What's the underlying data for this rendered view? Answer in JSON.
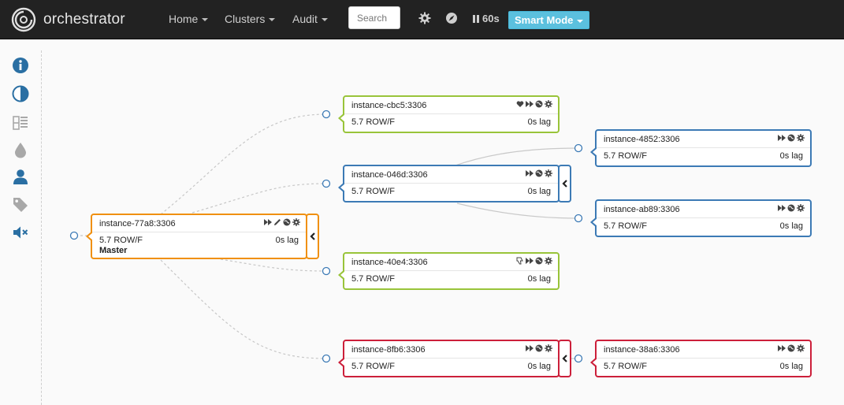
{
  "app": {
    "brand": "orchestrator"
  },
  "nav": {
    "home": "Home",
    "clusters": "Clusters",
    "audit": "Audit",
    "search_placeholder": "Search",
    "refresh": "60s",
    "mode": "Smart Mode"
  },
  "sidebar": [
    {
      "icon": "info-icon"
    },
    {
      "icon": "contrast-icon"
    },
    {
      "icon": "server-list-icon"
    },
    {
      "icon": "drop-icon"
    },
    {
      "icon": "user-icon"
    },
    {
      "icon": "tag-icon"
    },
    {
      "icon": "mute-icon"
    }
  ],
  "colors": {
    "master": "#f0900f",
    "ok": "#99c43a",
    "intermediate": "#3c7ab5",
    "error": "#cc1f3a",
    "accent": "#5bc0de",
    "sidebar_icon": "#2a6fa3"
  },
  "nodes": {
    "master": {
      "name": "instance-77a8:3306",
      "version": "5.7 ROW/F",
      "lag": "0s lag",
      "role": "Master"
    },
    "cbc5": {
      "name": "instance-cbc5:3306",
      "version": "5.7 ROW/F",
      "lag": "0s lag"
    },
    "n046d": {
      "name": "instance-046d:3306",
      "version": "5.7 ROW/F",
      "lag": "0s lag"
    },
    "n4852": {
      "name": "instance-4852:3306",
      "version": "5.7 ROW/F",
      "lag": "0s lag"
    },
    "ab89": {
      "name": "instance-ab89:3306",
      "version": "5.7 ROW/F",
      "lag": "0s lag"
    },
    "n40e4": {
      "name": "instance-40e4:3306",
      "version": "5.7 ROW/F",
      "lag": "0s lag"
    },
    "n8fb6": {
      "name": "instance-8fb6:3306",
      "version": "5.7 ROW/F",
      "lag": "0s lag"
    },
    "n38a6": {
      "name": "instance-38a6:3306",
      "version": "5.7 ROW/F",
      "lag": "0s lag"
    }
  }
}
